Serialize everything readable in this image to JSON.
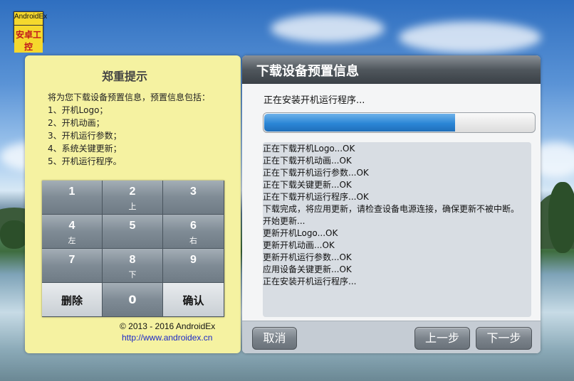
{
  "logo": {
    "line1": "AndroidEx",
    "line2": "安卓工控"
  },
  "notice": {
    "title": "郑重提示",
    "lines": [
      "将为您下载设备预置信息，预置信息包括：",
      "1、开机Logo；",
      "2、开机动画；",
      "3、开机运行参数；",
      "4、系统关键更新；",
      "5、开机运行程序。"
    ]
  },
  "keypad": {
    "keys": [
      {
        "num": "1",
        "sub": ""
      },
      {
        "num": "2",
        "sub": "上"
      },
      {
        "num": "3",
        "sub": ""
      },
      {
        "num": "4",
        "sub": "左"
      },
      {
        "num": "5",
        "sub": ""
      },
      {
        "num": "6",
        "sub": "右"
      },
      {
        "num": "7",
        "sub": ""
      },
      {
        "num": "8",
        "sub": "下"
      },
      {
        "num": "9",
        "sub": ""
      }
    ],
    "delete_label": "删除",
    "zero_label": "0",
    "confirm_label": "确认"
  },
  "copyright": "© 2013 - 2016 AndroidEx",
  "website": "http://www.androidex.cn",
  "main": {
    "header": "下载设备预置信息",
    "status": "正在安装开机运行程序...",
    "progress_percent": 71,
    "log": [
      "正在下载开机Logo...OK",
      "正在下载开机动画...OK",
      "正在下载开机运行参数...OK",
      "正在下载关键更新...OK",
      "正在下载开机运行程序...OK",
      "下载完成，将应用更新，请检查设备电源连接，确保更新不被中断。",
      "开始更新...",
      "更新开机Logo...OK",
      "更新开机动画...OK",
      "更新开机运行参数...OK",
      "应用设备关键更新...OK",
      "正在安装开机运行程序..."
    ]
  },
  "buttons": {
    "cancel": "取消",
    "prev": "上一步",
    "next": "下一步"
  },
  "colors": {
    "notice_bg": "#f5f2a1",
    "progress": "#2b86d6",
    "link": "#1a27c8"
  }
}
